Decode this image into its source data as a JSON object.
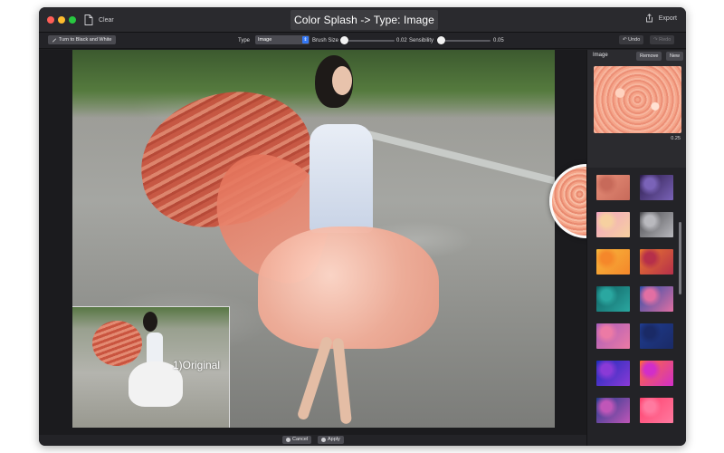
{
  "window": {
    "clear_label": "Clear",
    "title": "Color Splash -> Type: Image",
    "export_label": "Export"
  },
  "toolbar": {
    "bw_button": "Turn to Black and White",
    "type_label": "Type",
    "type_value": "Image",
    "brush_label": "Brush Size",
    "brush_value": "0.02",
    "sens_label": "Sensibility",
    "sens_value": "0.05",
    "undo_label": "Undo",
    "redo_label": "Redo"
  },
  "canvas": {
    "inset_label": "1)Original"
  },
  "bottom": {
    "cancel_label": "Cancel",
    "apply_label": "Apply"
  },
  "panel": {
    "label": "Image",
    "remove_label": "Remove",
    "new_label": "New",
    "value": "0.25",
    "swatches": [
      {
        "name": "swatch-pink-glitter",
        "c1": "#e8907a",
        "c2": "#c76a5a"
      },
      {
        "name": "swatch-purple-galaxy",
        "c1": "#2b1b4a",
        "c2": "#7a63b8"
      },
      {
        "name": "swatch-pastel-bokeh",
        "c1": "#f2a5c2",
        "c2": "#f6d0a0"
      },
      {
        "name": "swatch-silver-sparkle",
        "c1": "#4b4b4f",
        "c2": "#b9b9be"
      },
      {
        "name": "swatch-gold-bokeh",
        "c1": "#f6b73c",
        "c2": "#f5872a"
      },
      {
        "name": "swatch-orange-bokeh",
        "c1": "#e9782f",
        "c2": "#b62f4a"
      },
      {
        "name": "swatch-teal-glitter",
        "c1": "#0f5f61",
        "c2": "#2aa7a0"
      },
      {
        "name": "swatch-neon-stripes",
        "c1": "#2e4ea8",
        "c2": "#e26fa3"
      },
      {
        "name": "swatch-violet-glitter",
        "c1": "#a85dbb",
        "c2": "#ec7aa5"
      },
      {
        "name": "swatch-blue-glitter",
        "c1": "#1f3c8f",
        "c2": "#1a2a66"
      },
      {
        "name": "swatch-blue-gradient",
        "c1": "#1d2dbb",
        "c2": "#8a3ad6"
      },
      {
        "name": "swatch-rainbow-gradient",
        "c1": "#ff6b3a",
        "c2": "#d12ec9"
      },
      {
        "name": "swatch-cosmic-bokeh",
        "c1": "#243b8c",
        "c2": "#c056b8"
      },
      {
        "name": "swatch-pink-gradient",
        "c1": "#ff3f6c",
        "c2": "#ff7aa0"
      }
    ]
  }
}
